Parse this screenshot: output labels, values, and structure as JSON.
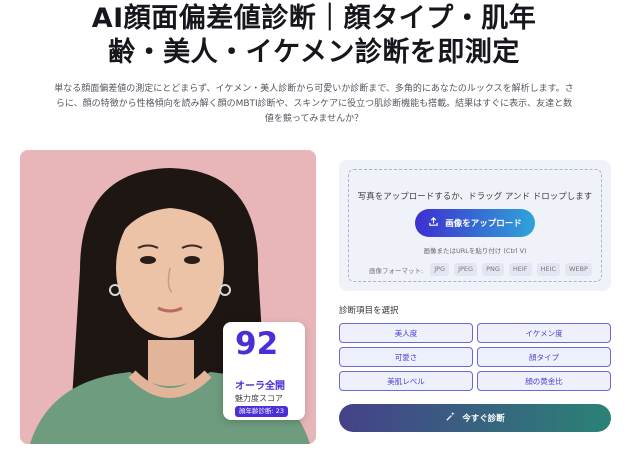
{
  "header": {
    "title_line1": "AI顔面偏差値診断｜顔タイプ・肌年",
    "title_line2": "齢・美人・イケメン診断を即測定",
    "description": "単なる顔面偏差値の測定にとどまらず、イケメン・美人診断から可愛いか診断まで、多角的にあなたのルックスを解析します。さらに、顔の特徴から性格傾向を読み解く顔のMBTI診断や、スキンケアに役立つ肌診断機能も搭載。結果はすぐに表示、友達と数値を競ってみませんか？"
  },
  "score_card": {
    "score": "92",
    "name": "オーラ全開",
    "subtitle": "魅力度スコア",
    "badge": "顔年齢診断: 23"
  },
  "upload": {
    "prompt": "写真をアップロードするか、ドラッグ アンド ドロップします",
    "button_label": "画像をアップロード",
    "paste_hint": "画像またはURLを貼り付け (Ctrl V)",
    "formats_label": "画像フォーマット:",
    "formats": [
      "JPG",
      "JPEG",
      "PNG",
      "HEIF",
      "HEIC",
      "WEBP"
    ]
  },
  "diagnosis": {
    "label": "診断項目を選択",
    "options": [
      "美人度",
      "イケメン度",
      "可愛さ",
      "顔タイプ",
      "美肌レベル",
      "顔の黄金比"
    ]
  },
  "action": {
    "button_label": "今すぐ診断"
  },
  "colors": {
    "accent": "#4b2ed6",
    "option_border": "#6c68d8",
    "photo_bg": "#e8b6b9",
    "panel_bg": "#f0f2fa"
  }
}
